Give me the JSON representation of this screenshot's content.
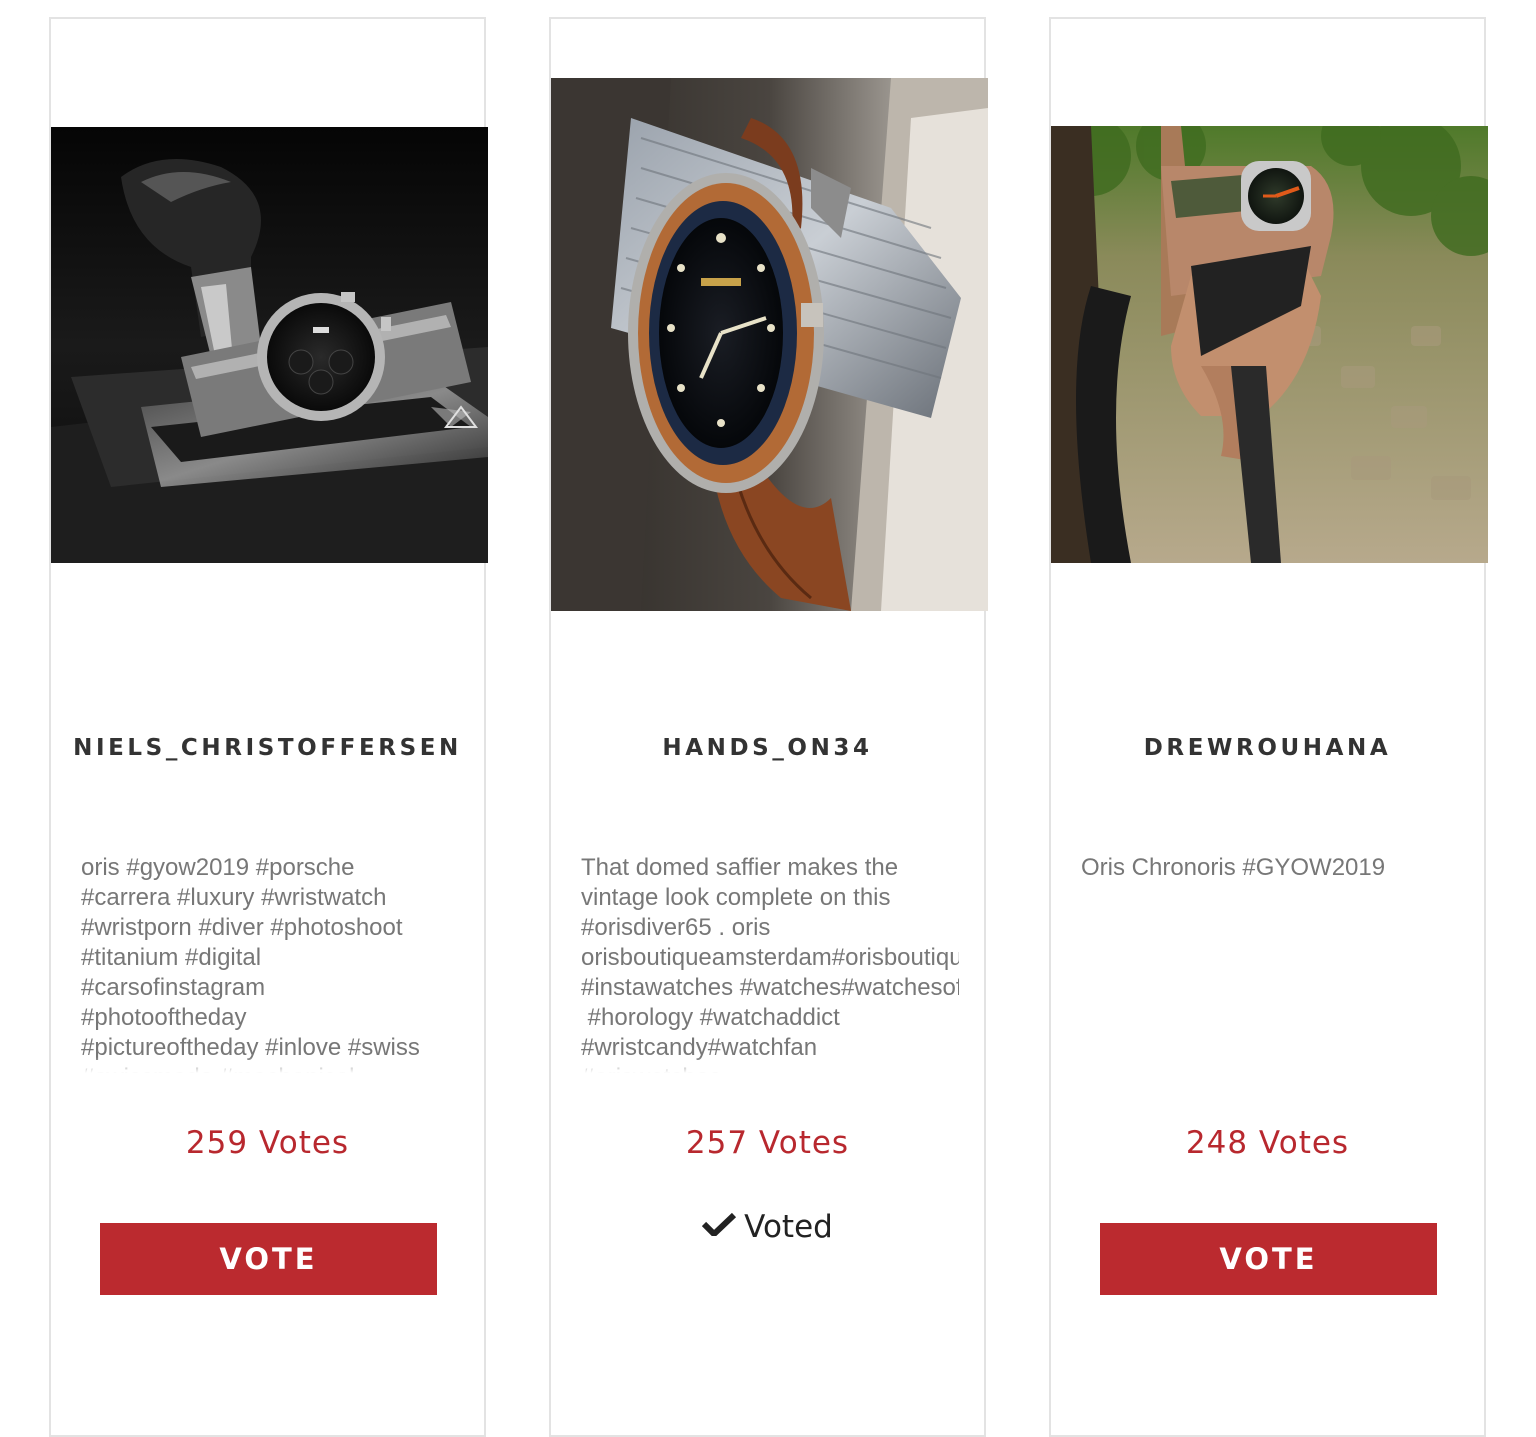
{
  "entries": [
    {
      "username": "NIELS_CHRISTOFFERSEN",
      "caption": "oris #gyow2019 #porsche\n#carrera #luxury #wristwatch\n#wristporn #diver #photoshoot\n#titanium #digital\n#carsofinstagram\n#photooftheday\n#pictureoftheday #inlove #swiss\n#swissmade #mechanical",
      "votes": "259 Votes",
      "button_label": "VOTE",
      "photo_icon": "watch-on-gear-shifter-photo"
    },
    {
      "username": "HANDS_ON34",
      "caption": "That domed saffier makes the\nvintage look complete on this\n#orisdiver65 . oris\norisboutiqueamsterdam#orisboutique\n#instawatches #watches#watchesofinstagram\n #horology #watchaddict\n#wristcandy#watchfan\n#oriswatches",
      "votes": "257 Votes",
      "status_label": "Voted",
      "photo_icon": "watch-on-wooden-post-photo"
    },
    {
      "username": "DREWROUHANA",
      "caption": "Oris Chronoris #GYOW2019",
      "votes": "248 Votes",
      "button_label": "VOTE",
      "photo_icon": "watch-on-wrist-bicycle-photo"
    }
  ],
  "colors": {
    "accent": "#bb2a2f",
    "votes_text": "#b8282e",
    "username_text": "#333333",
    "caption_text": "#777777",
    "card_border": "#e3e3e3"
  }
}
